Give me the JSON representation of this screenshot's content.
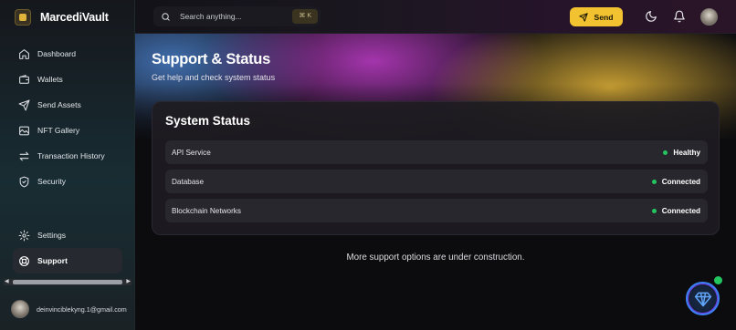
{
  "app": {
    "name": "MarcediVault"
  },
  "sidebar": {
    "items": [
      {
        "label": "Dashboard",
        "icon": "home-icon"
      },
      {
        "label": "Wallets",
        "icon": "wallet-icon"
      },
      {
        "label": "Send Assets",
        "icon": "send-icon"
      },
      {
        "label": "NFT Gallery",
        "icon": "gallery-icon"
      },
      {
        "label": "Transaction History",
        "icon": "transfer-icon"
      },
      {
        "label": "Security",
        "icon": "shield-icon"
      }
    ],
    "bottom_items": [
      {
        "label": "Settings",
        "icon": "gear-icon"
      },
      {
        "label": "Support",
        "icon": "lifebuoy-icon",
        "active": true
      }
    ],
    "user_email": "deinvinciblekyng.1@gmail.com"
  },
  "topbar": {
    "search_placeholder": "Search anything...",
    "shortcut": "⌘ K",
    "send_label": "Send"
  },
  "page": {
    "title": "Support & Status",
    "subtitle": "Get help and check system status"
  },
  "system_status": {
    "title": "System Status",
    "rows": [
      {
        "name": "API Service",
        "status": "Healthy",
        "color": "#22c55e"
      },
      {
        "name": "Database",
        "status": "Connected",
        "color": "#22c55e"
      },
      {
        "name": "Blockchain Networks",
        "status": "Connected",
        "color": "#22c55e"
      }
    ]
  },
  "note": "More support options are under construction.",
  "colors": {
    "accent": "#f2c230",
    "status_ok": "#22c55e",
    "fab_ring": "#3b82f6"
  }
}
